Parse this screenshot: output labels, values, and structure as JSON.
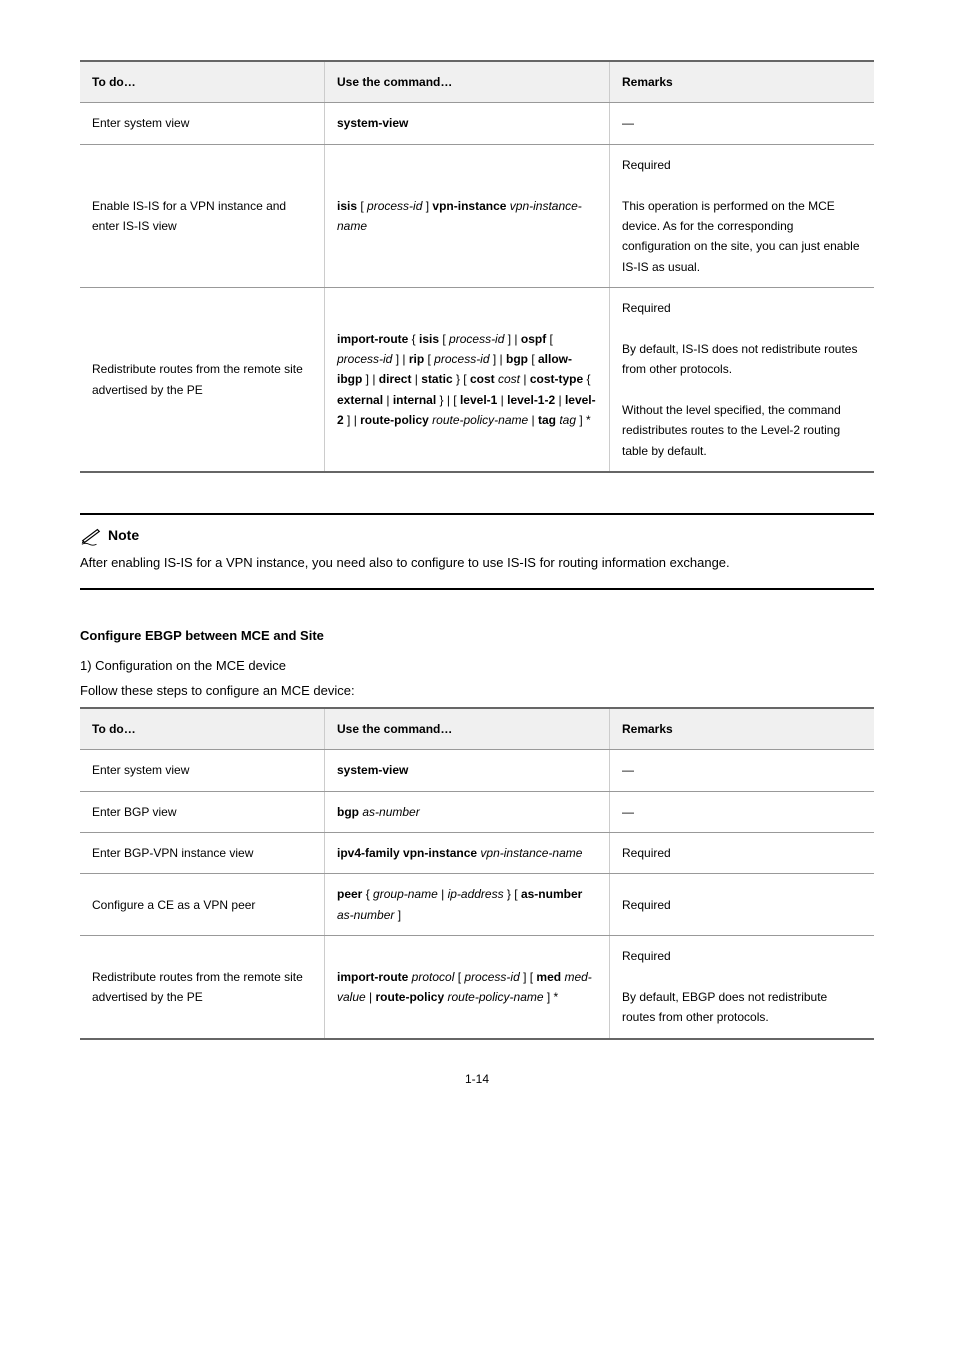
{
  "table1": {
    "headers": [
      "To do…",
      "Use the command…",
      "Remarks"
    ],
    "rows": [
      {
        "desc": "Enter system view",
        "cmd": "system-view",
        "remarks": "—"
      },
      {
        "desc": "Enable IS-IS for a VPN instance and enter IS-IS view",
        "cmd": "isis [ process-id ] vpn-instance vpn-instance-name",
        "remarks": "Required\nThis operation is performed on the MCE device. As for the corresponding configuration on the site, you can just enable IS-IS as usual."
      },
      {
        "desc": "Redistribute routes from the remote site advertised by the PE",
        "cmd": "import-route { isis [ process-id ] | ospf [ process-id ] | rip [ process-id ] | bgp [ allow-ibgp ] | direct | static } [ cost cost | cost-type { external | internal } | [ level-1 | level-1-2 | level-2 ] | route-policy route-policy-name | tag tag ] *",
        "remarks": "Required\nBy default, IS-IS does not redistribute routes from other protocols.\nWithout the level specified, the command redistributes routes to the Level-2 routing table by default."
      }
    ]
  },
  "note": {
    "label": "Note",
    "text": "After enabling IS-IS for a VPN instance, you need also to configure to use IS-IS for routing information exchange."
  },
  "section": {
    "heading": "Configure EBGP between MCE and Site",
    "sub1": "1)   Configuration on the MCE device",
    "sub2": "Follow these steps to configure an MCE device:"
  },
  "table2": {
    "headers": [
      "To do…",
      "Use the command…",
      "Remarks"
    ],
    "rows": [
      {
        "desc": "Enter system view",
        "cmd": "system-view",
        "remarks": "—"
      },
      {
        "desc": "Enter BGP view",
        "cmd": "bgp as-number",
        "remarks": "—"
      },
      {
        "desc": "Enter BGP-VPN instance view",
        "cmd": "ipv4-family vpn-instance vpn-instance-name",
        "remarks": "Required"
      },
      {
        "desc": "Configure a CE as a VPN peer",
        "cmd": "peer { group-name | ip-address } [ as-number as-number ]",
        "remarks": "Required"
      },
      {
        "desc": "Redistribute routes from the remote site advertised by the PE",
        "cmd": "import-route protocol [ process-id ] [ med med-value | route-policy route-policy-name ] *",
        "remarks": "Required\nBy default, EBGP does not redistribute routes from other protocols."
      }
    ]
  },
  "pageNumber": "1-14"
}
